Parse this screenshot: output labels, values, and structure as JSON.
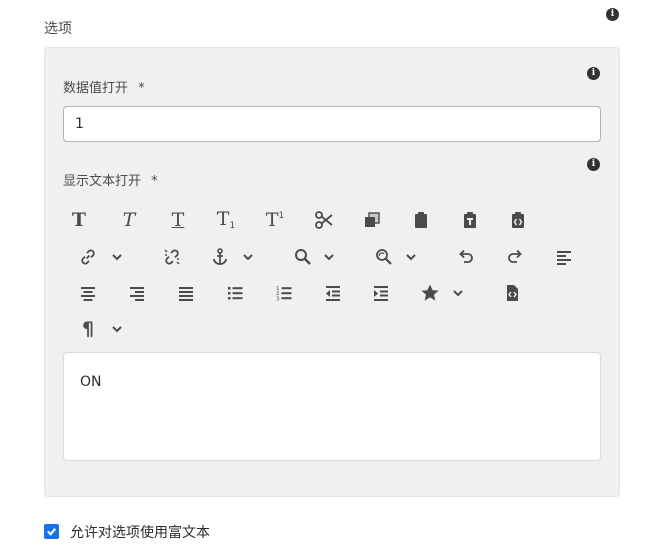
{
  "section": {
    "title": "选项"
  },
  "fields": {
    "data_value": {
      "label": "数据值打开",
      "required_mark": "*",
      "value": "1"
    },
    "display_text": {
      "label": "显示文本打开",
      "required_mark": "*"
    }
  },
  "toolbar": {
    "bold": "T",
    "italic": "T",
    "underline": "T",
    "subscript_base": "T",
    "subscript_mark": "1",
    "superscript_base": "T",
    "superscript_mark": "1",
    "pilcrow": "¶"
  },
  "editor": {
    "content": "ON"
  },
  "rich_text_option": {
    "label": "允许对选项使用富文本",
    "checked": true
  },
  "icons": {
    "info": "info-icon",
    "accent": "#1473e6"
  }
}
